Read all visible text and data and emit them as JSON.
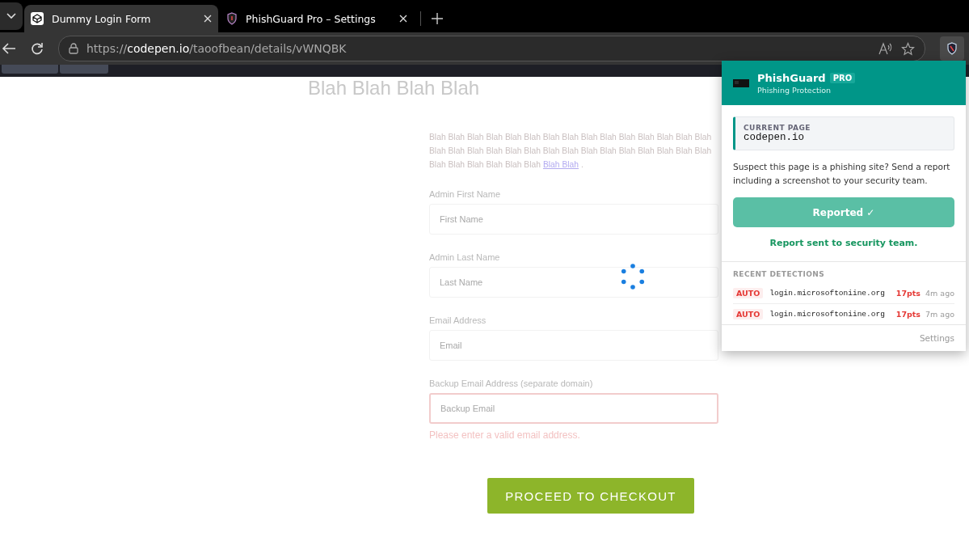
{
  "browser": {
    "tabs": [
      {
        "title": "Dummy Login Form",
        "selected": true
      },
      {
        "title": "PhishGuard Pro – Settings",
        "selected": false
      }
    ],
    "url": {
      "scheme": "https://",
      "host": "codepen.io",
      "path": "/taoofbean/details/vWNQBK"
    }
  },
  "page": {
    "heading": "Blah Blah Blah Blah",
    "intro_lines": [
      "Blah Blah Blah Blah Blah Blah Blah Blah Blah Blah Blah Blah Blah Blah Blah",
      "Blah Blah Blah Blah Blah Blah Blah Blah Blah Blah Blah Blah Blah Blah Blah"
    ],
    "intro_last": "Blah Blah Blah Blah Blah Blah",
    "intro_link": "Blah Blah ",
    "intro_end": ".",
    "fields": [
      {
        "label": "Admin First Name",
        "placeholder": "First Name",
        "invalid": false
      },
      {
        "label": "Admin Last Name",
        "placeholder": "Last Name",
        "invalid": false
      },
      {
        "label": "Email Address",
        "placeholder": "Email",
        "invalid": false
      },
      {
        "label": "Backup Email Address (separate domain)",
        "placeholder": "Backup Email",
        "invalid": true,
        "error": "Please enter a valid email address."
      }
    ],
    "submit": "PROCEED TO CHECKOUT",
    "loading": true
  },
  "popup": {
    "title": "PhishGuard",
    "badge": "PRO",
    "subtitle": "Phishing Protection",
    "current_page_label": "CURRENT PAGE",
    "current_page": "codepen.io",
    "description": "Suspect this page is a phishing site? Send a report including a screenshot to your security team.",
    "report_button": "Reported ✓",
    "report_done": true,
    "status": "Report sent to security team.",
    "recent_title": "RECENT DETECTIONS",
    "detections": [
      {
        "tag": "AUTO",
        "domain": "login.microsoftoniine.org",
        "score": "17pts",
        "time": "4m ago"
      },
      {
        "tag": "AUTO",
        "domain": "login.microsoftoniine.org",
        "score": "17pts",
        "time": "7m ago"
      }
    ],
    "settings": "Settings"
  }
}
